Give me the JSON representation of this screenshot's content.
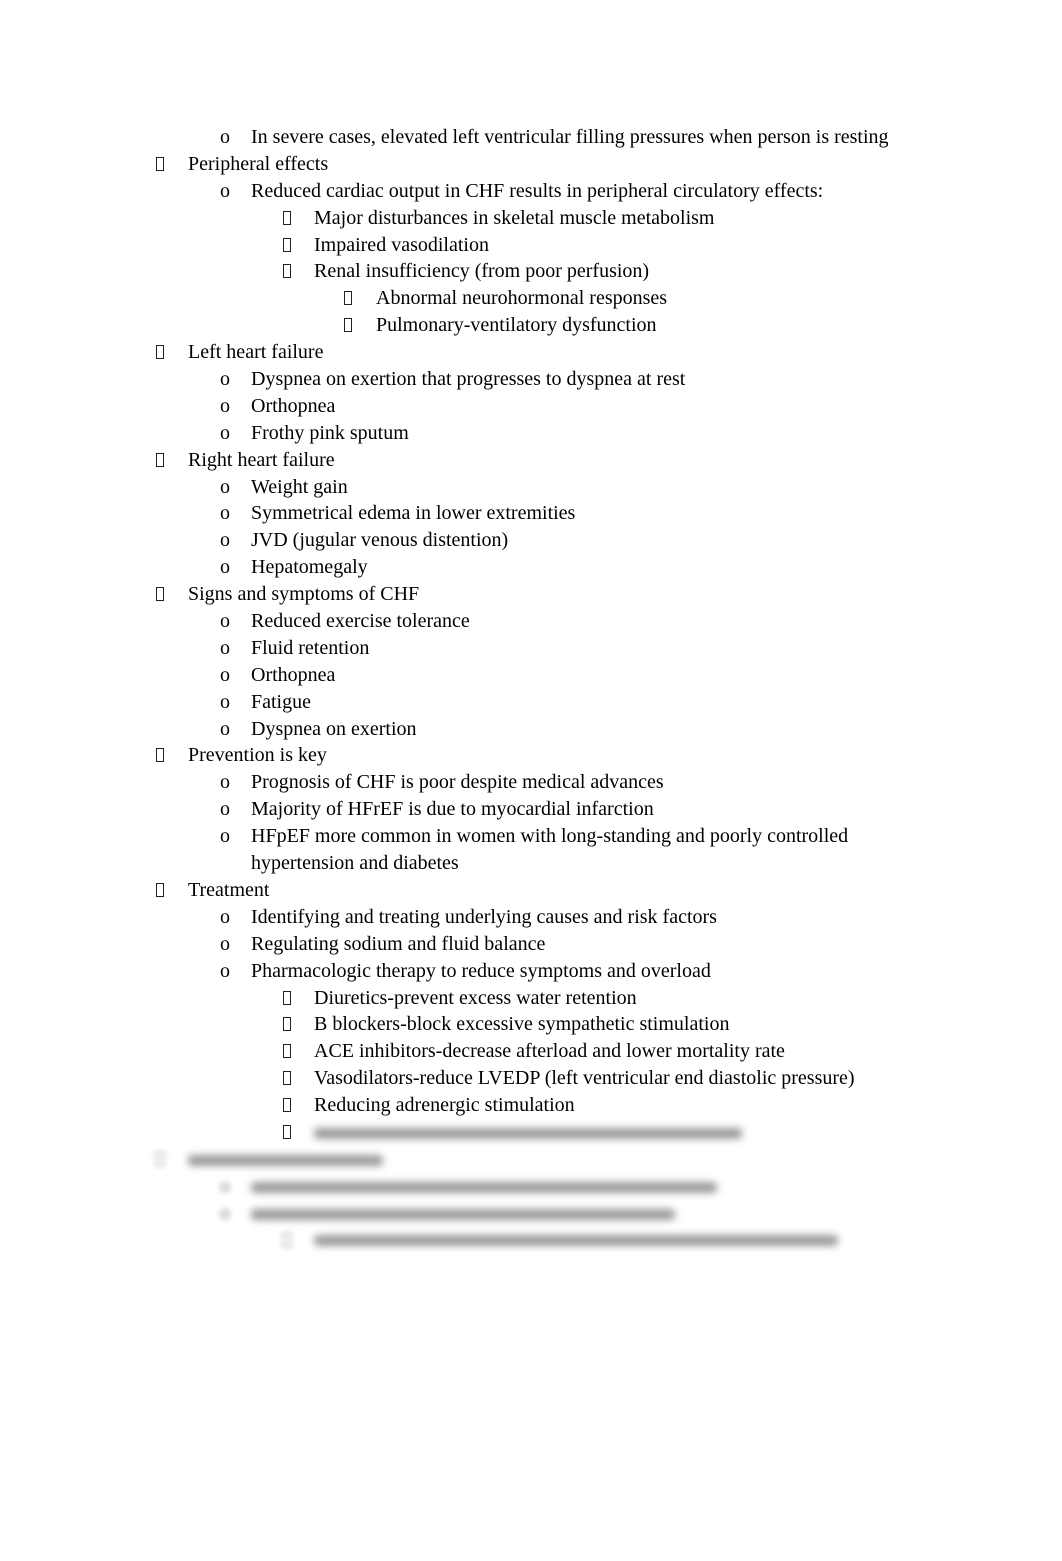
{
  "document": {
    "items": [
      {
        "level": 1,
        "marker": "o",
        "text": "In severe cases, elevated left ventricular filling pressures when person is resting"
      },
      {
        "level": 0,
        "marker": "box",
        "text": "Peripheral effects"
      },
      {
        "level": 1,
        "marker": "o",
        "text": "Reduced cardiac output in CHF results in peripheral circulatory effects:"
      },
      {
        "level": 2,
        "marker": "box",
        "text": "Major disturbances in skeletal muscle metabolism"
      },
      {
        "level": 2,
        "marker": "box",
        "text": "Impaired vasodilation"
      },
      {
        "level": 2,
        "marker": "box",
        "text": "Renal insufficiency (from poor perfusion)"
      },
      {
        "level": 3,
        "marker": "box",
        "text": "Abnormal neurohormonal responses"
      },
      {
        "level": 3,
        "marker": "box",
        "text": "Pulmonary-ventilatory dysfunction"
      },
      {
        "level": 0,
        "marker": "box",
        "text": "Left heart failure"
      },
      {
        "level": 1,
        "marker": "o",
        "text": "Dyspnea on exertion that progresses to dyspnea at rest"
      },
      {
        "level": 1,
        "marker": "o",
        "text": "Orthopnea"
      },
      {
        "level": 1,
        "marker": "o",
        "text": "Frothy pink sputum"
      },
      {
        "level": 0,
        "marker": "box",
        "text": "Right heart failure"
      },
      {
        "level": 1,
        "marker": "o",
        "text": "Weight gain"
      },
      {
        "level": 1,
        "marker": "o",
        "text": "Symmetrical edema in lower extremities"
      },
      {
        "level": 1,
        "marker": "o",
        "text": "JVD (jugular venous distention)"
      },
      {
        "level": 1,
        "marker": "o",
        "text": "Hepatomegaly"
      },
      {
        "level": 0,
        "marker": "box",
        "text": "Signs and symptoms of CHF"
      },
      {
        "level": 1,
        "marker": "o",
        "text": "Reduced exercise tolerance"
      },
      {
        "level": 1,
        "marker": "o",
        "text": "Fluid retention"
      },
      {
        "level": 1,
        "marker": "o",
        "text": "Orthopnea"
      },
      {
        "level": 1,
        "marker": "o",
        "text": "Fatigue"
      },
      {
        "level": 1,
        "marker": "o",
        "text": "Dyspnea on exertion"
      },
      {
        "level": 0,
        "marker": "box",
        "text": "Prevention is key"
      },
      {
        "level": 1,
        "marker": "o",
        "text": "Prognosis of CHF is poor despite medical advances"
      },
      {
        "level": 1,
        "marker": "o",
        "text": "Majority of HFrEF is due to myocardial infarction"
      },
      {
        "level": 1,
        "marker": "o",
        "text": "HFpEF more common in women with long-standing and poorly controlled"
      },
      {
        "level": 1,
        "marker": "",
        "text": "hypertension and diabetes"
      },
      {
        "level": 0,
        "marker": "box",
        "text": "Treatment"
      },
      {
        "level": 1,
        "marker": "o",
        "text": "Identifying and treating underlying causes and risk factors"
      },
      {
        "level": 1,
        "marker": "o",
        "text": "Regulating sodium and fluid balance"
      },
      {
        "level": 1,
        "marker": "o",
        "text": "Pharmacologic therapy to reduce symptoms and overload"
      },
      {
        "level": 2,
        "marker": "box",
        "text": "Diuretics-prevent excess water retention"
      },
      {
        "level": 2,
        "marker": "box",
        "text": "B blockers-block excessive sympathetic stimulation"
      },
      {
        "level": 2,
        "marker": "box",
        "text": "ACE inhibitors-decrease afterload and lower mortality rate"
      },
      {
        "level": 2,
        "marker": "box",
        "text": "Vasodilators-reduce LVEDP (left ventricular end diastolic pressure)"
      },
      {
        "level": 2,
        "marker": "box",
        "text": "Reducing adrenergic stimulation"
      },
      {
        "level": 2,
        "marker": "box",
        "blurred": true,
        "blur_marker_visible": true
      },
      {
        "level": 0,
        "marker": "box",
        "blurred": true
      },
      {
        "level": 1,
        "marker": "o",
        "blurred": true
      },
      {
        "level": 1,
        "marker": "o",
        "blurred": true
      },
      {
        "level": 2,
        "marker": "box",
        "blurred": true
      }
    ]
  }
}
